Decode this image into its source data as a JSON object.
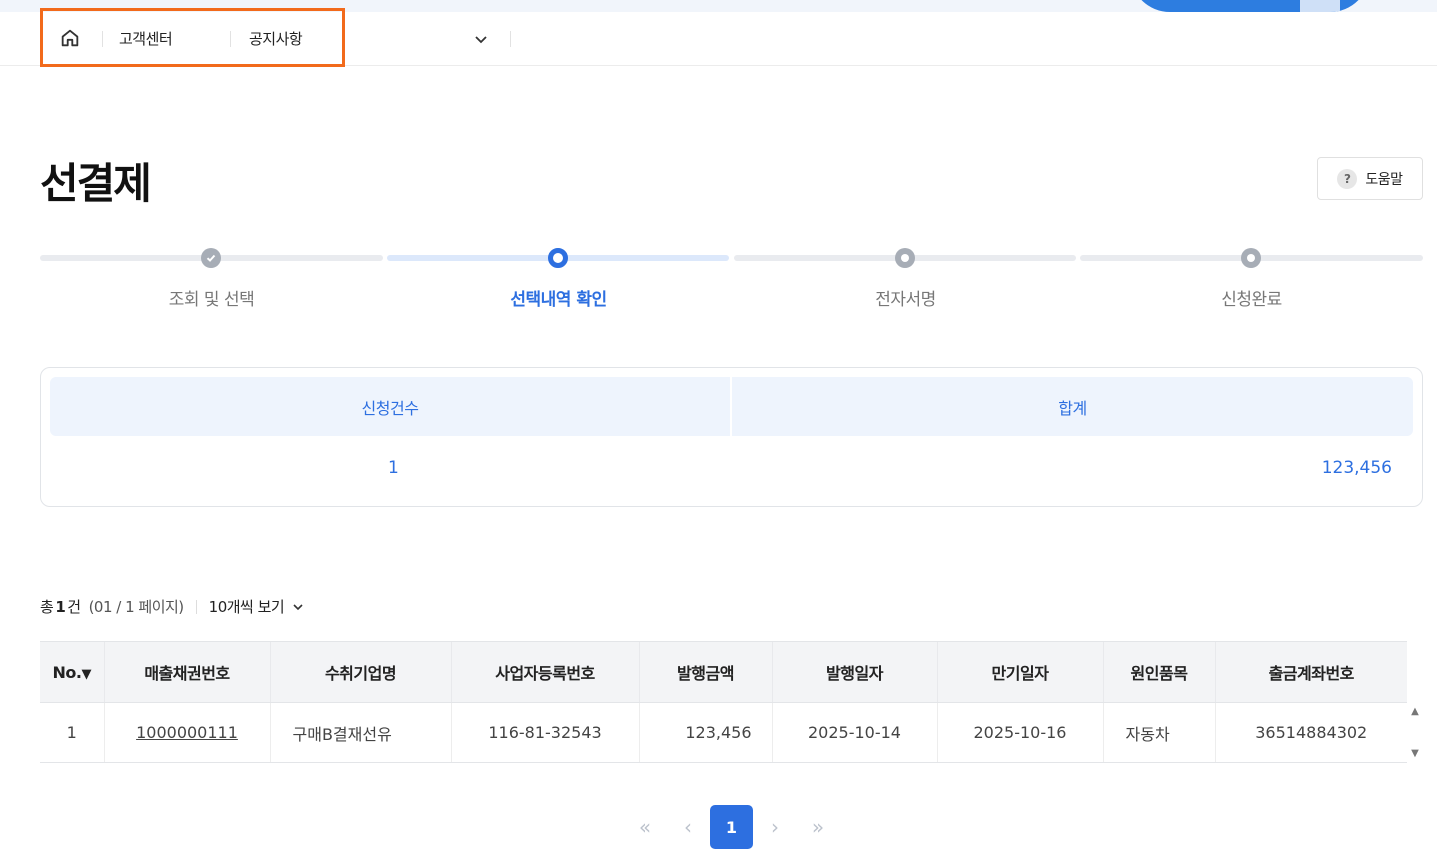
{
  "breadcrumb": {
    "items": [
      "고객센터",
      "공지사항"
    ]
  },
  "page": {
    "title": "선결제",
    "help_label": "도움말",
    "help_icon_glyph": "?"
  },
  "steps": [
    {
      "label": "조회 및 선택",
      "state": "done"
    },
    {
      "label": "선택내역 확인",
      "state": "current"
    },
    {
      "label": "전자서명",
      "state": "pending"
    },
    {
      "label": "신청완료",
      "state": "pending"
    }
  ],
  "summary": {
    "count_header": "신청건수",
    "total_header": "합계",
    "count_value": "1",
    "total_value": "123,456"
  },
  "list_info": {
    "total_prefix": "총",
    "total_count": "1",
    "total_suffix": "건",
    "pages": "(01 / 1 페이지)",
    "page_size": "10개씩 보기"
  },
  "table": {
    "headers": [
      "No.",
      "매출채권번호",
      "수취기업명",
      "사업자등록번호",
      "발행금액",
      "발행일자",
      "만기일자",
      "원인품목",
      "출금계좌번호"
    ],
    "sort_arrow": "▼",
    "rows": [
      [
        "1",
        "1000000111",
        "구매B결재선유",
        "116-81-32543",
        "123,456",
        "2025-10-14",
        "2025-10-16",
        "자동차",
        "36514884302"
      ]
    ]
  },
  "pagination": {
    "first": "«",
    "prev": "‹",
    "current": "1",
    "next": "›",
    "last": "»"
  },
  "colors": {
    "accent": "#2d6fe0",
    "highlight_border": "#f26a1b",
    "header_bg": "#eef4fd"
  },
  "icons": {
    "home": "home-icon",
    "dropdown": "chevron-down-icon",
    "help": "question-icon",
    "check": "check-icon"
  }
}
